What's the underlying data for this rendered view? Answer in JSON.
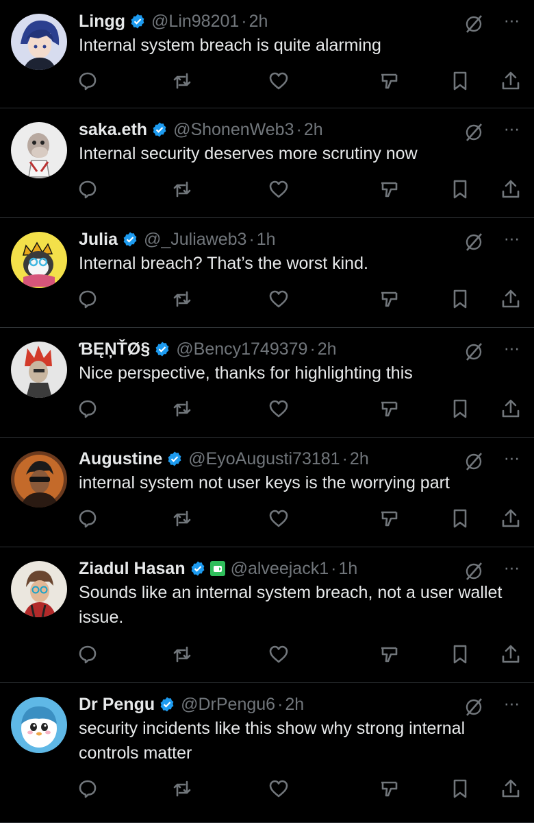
{
  "colors": {
    "background": "#000000",
    "text": "#e7e9ea",
    "muted": "#71767b",
    "verified": "#1d9bf0",
    "divider": "#2f3336"
  },
  "icons": [
    "reply-icon",
    "retweet-icon",
    "like-icon",
    "dislike-icon",
    "bookmark-icon",
    "share-icon",
    "grok-icon",
    "more-icon",
    "verified-badge-icon"
  ],
  "tweets": [
    {
      "name": "Lingg",
      "handle": "@Lin98201",
      "dot": "·",
      "time": "2h",
      "text": "Internal system breach is quite alarming"
    },
    {
      "name": "saka.eth",
      "handle": "@ShonenWeb3",
      "dot": "·",
      "time": "2h",
      "text": "Internal security deserves more scrutiny now"
    },
    {
      "name": "Julia",
      "handle": "@_Juliaweb3",
      "dot": "·",
      "time": "1h",
      "text": "Internal breach? That’s the worst kind."
    },
    {
      "name": "ƁĘŅŤØ§",
      "handle": "@Bency1749379",
      "dot": "·",
      "time": "2h",
      "text": "Nice perspective, thanks for highlighting this"
    },
    {
      "name": "Augustine",
      "handle": "@EyoAugusti73181",
      "dot": "·",
      "time": "2h",
      "text": "internal system not user keys is the worrying part"
    },
    {
      "name": "Ziadul Hasan",
      "handle": "@alveejack1",
      "dot": "·",
      "time": "1h",
      "text": "Sounds like an internal system breach, not a user wallet issue."
    },
    {
      "name": "Dr Pengu",
      "handle": "@DrPengu6",
      "dot": "·",
      "time": "2h",
      "text": "security incidents like this show why strong internal controls matter"
    }
  ],
  "more_label": "···"
}
